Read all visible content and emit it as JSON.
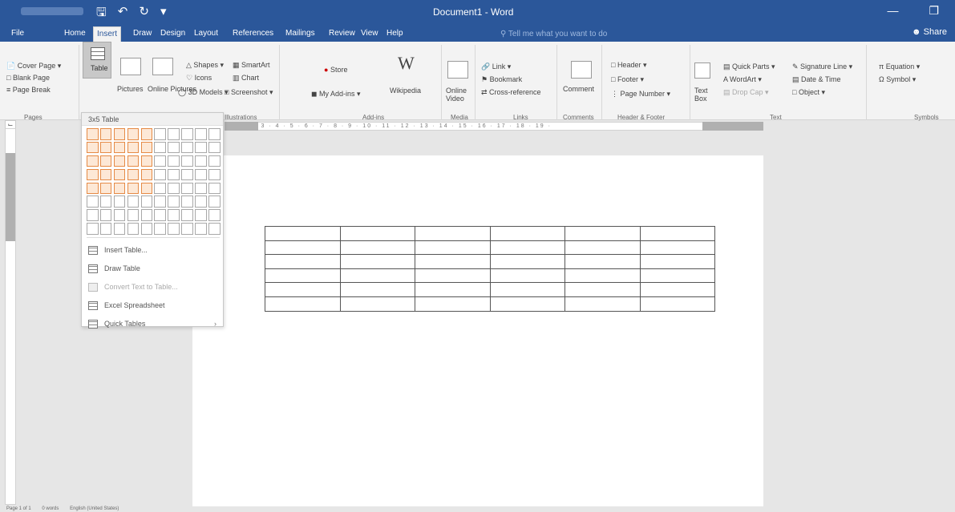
{
  "titlebar": {
    "doc_title": "Document1 - Word"
  },
  "tabs": [
    "File",
    "Home",
    "Insert",
    "Draw",
    "Design",
    "Layout",
    "References",
    "Mailings",
    "Review",
    "View",
    "Help"
  ],
  "active_tab": "Insert",
  "tell_me_placeholder": "Tell me what you want to do",
  "share_label": "Share",
  "ribbon": {
    "pages": {
      "cover_page": "Cover Page",
      "blank_page": "Blank Page",
      "page_break": "Page Break",
      "group": "Pages"
    },
    "tables": {
      "table": "Table"
    },
    "illustrations": {
      "pictures": "Pictures",
      "online_pictures": "Online Pictures",
      "shapes": "Shapes",
      "icons": "Icons",
      "models": "3D Models",
      "smartart": "SmartArt",
      "chart": "Chart",
      "screenshot": "Screenshot",
      "group": "Illustrations"
    },
    "addins": {
      "store": "Store",
      "my_addins": "My Add-ins",
      "wikipedia": "Wikipedia",
      "group": "Add-ins"
    },
    "media": {
      "online_video": "Online Video",
      "group": "Media"
    },
    "links": {
      "link": "Link",
      "bookmark": "Bookmark",
      "cross_reference": "Cross-reference",
      "group": "Links"
    },
    "comments": {
      "comment": "Comment",
      "group": "Comments"
    },
    "header_footer": {
      "header": "Header",
      "footer": "Footer",
      "page_number": "Page Number",
      "group": "Header & Footer"
    },
    "text": {
      "text_box": "Text Box",
      "quick_parts": "Quick Parts",
      "wordart": "WordArt",
      "drop_cap": "Drop Cap",
      "signature_line": "Signature Line",
      "date_time": "Date & Time",
      "object": "Object",
      "group": "Text"
    },
    "symbols": {
      "equation": "Equation",
      "symbol": "Symbol",
      "group": "Symbols"
    }
  },
  "insert_table_menu": {
    "header": "3x5 Table",
    "grid_cols": 10,
    "grid_rows": 8,
    "selected_cols": 5,
    "selected_rows": 5,
    "items": [
      {
        "label": "Insert Table...",
        "disabled": false
      },
      {
        "label": "Draw Table",
        "disabled": false
      },
      {
        "label": "Convert Text to Table...",
        "disabled": true
      },
      {
        "label": "Excel Spreadsheet",
        "disabled": false
      },
      {
        "label": "Quick Tables",
        "disabled": false,
        "submenu": true
      }
    ]
  },
  "document": {
    "table_rows": 6,
    "table_cols": 6
  },
  "status": {
    "page": "Page 1 of 1",
    "words": "0 words",
    "proofing": "English (United States)"
  }
}
